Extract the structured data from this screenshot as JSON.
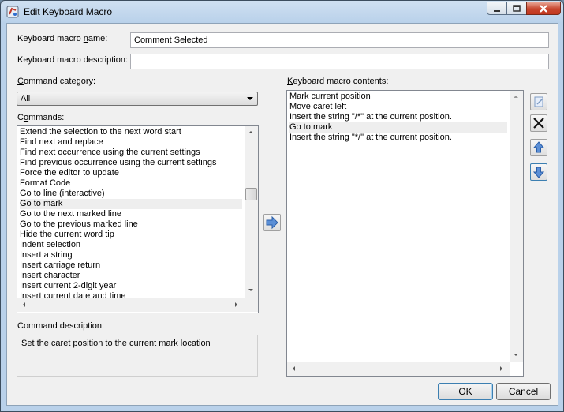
{
  "window": {
    "title": "Edit Keyboard Macro"
  },
  "form": {
    "name_label_pre": "Keyboard macro ",
    "name_label_ul": "n",
    "name_label_post": "ame:",
    "name_value": "Comment Selected",
    "desc_label": "Keyboard macro description:",
    "desc_value": ""
  },
  "category": {
    "label_pre": "",
    "label_ul": "C",
    "label_post": "ommand category:",
    "selected": "All"
  },
  "commands": {
    "label_pre": "C",
    "label_ul": "o",
    "label_post": "mmands:",
    "items": [
      "Extend the selection to the next word start",
      "Find next and replace",
      "Find next occurrence using the current settings",
      "Find previous occurrence using the current settings",
      "Force the editor to update",
      "Format Code",
      "Go to line (interactive)",
      "Go to mark",
      "Go to the next marked line",
      "Go to the previous marked line",
      "Hide the current word tip",
      "Indent selection",
      "Insert a string",
      "Insert carriage return",
      "Insert character",
      "Insert current 2-digit year",
      "Insert current date and time"
    ],
    "selected_index": 7
  },
  "command_description": {
    "label": "Command description:",
    "text": "Set the caret position to the current mark location"
  },
  "macro": {
    "label_ul": "K",
    "label_post": "eyboard macro contents:",
    "items": [
      "Mark current position",
      "Move caret left",
      "Insert the string \"/*\" at the current position.",
      "Go to mark",
      "Insert the string \"*/\" at the current position."
    ],
    "selected_index": 3
  },
  "buttons": {
    "ok": "OK",
    "cancel": "Cancel"
  },
  "colors": {
    "title_bg": "#b9d1ea",
    "close_red": "#c7462e",
    "arrow_blue": "#2f6fcf"
  }
}
